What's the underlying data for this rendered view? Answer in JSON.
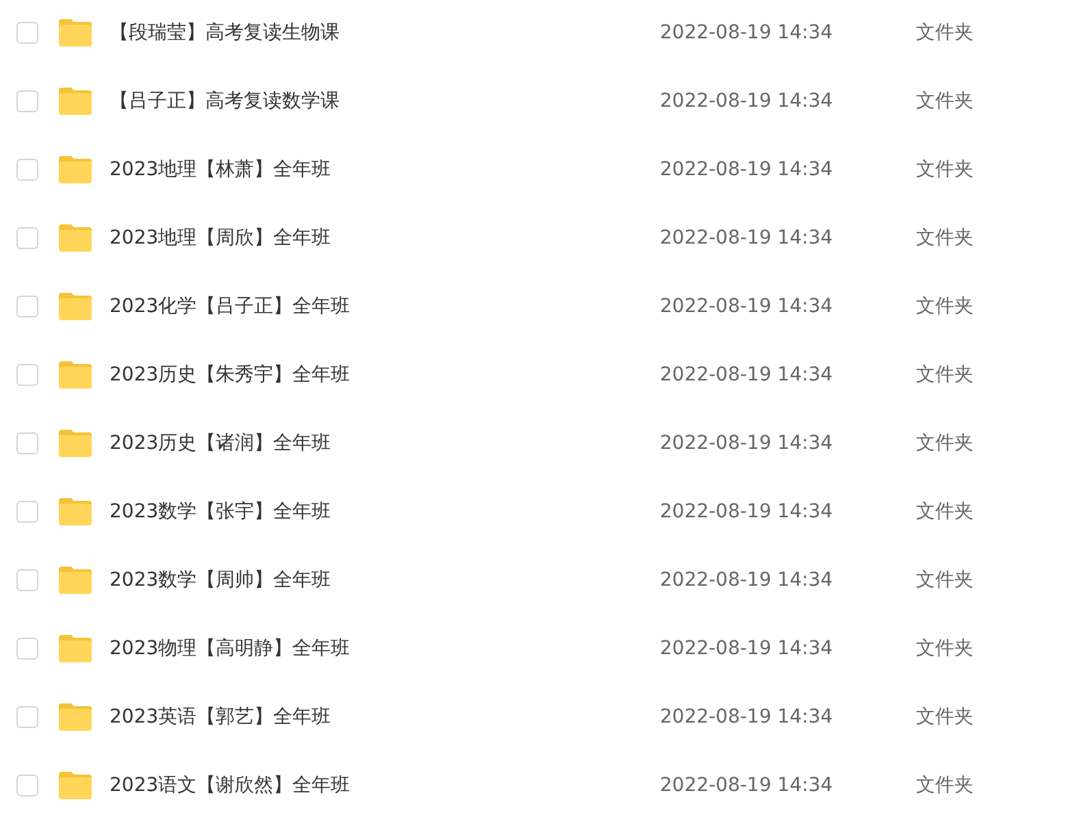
{
  "files": [
    {
      "name": "【段瑞莹】高考复读生物课",
      "modified": "2022-08-19 14:34",
      "type": "文件夹",
      "checked": false
    },
    {
      "name": "【吕子正】高考复读数学课",
      "modified": "2022-08-19 14:34",
      "type": "文件夹",
      "checked": false
    },
    {
      "name": "2023地理【林萧】全年班",
      "modified": "2022-08-19 14:34",
      "type": "文件夹",
      "checked": false
    },
    {
      "name": "2023地理【周欣】全年班",
      "modified": "2022-08-19 14:34",
      "type": "文件夹",
      "checked": false
    },
    {
      "name": "2023化学【吕子正】全年班",
      "modified": "2022-08-19 14:34",
      "type": "文件夹",
      "checked": false
    },
    {
      "name": "2023历史【朱秀宇】全年班",
      "modified": "2022-08-19 14:34",
      "type": "文件夹",
      "checked": false
    },
    {
      "name": "2023历史【诸润】全年班",
      "modified": "2022-08-19 14:34",
      "type": "文件夹",
      "checked": false
    },
    {
      "name": "2023数学【张宇】全年班",
      "modified": "2022-08-19 14:34",
      "type": "文件夹",
      "checked": false
    },
    {
      "name": "2023数学【周帅】全年班",
      "modified": "2022-08-19 14:34",
      "type": "文件夹",
      "checked": false
    },
    {
      "name": "2023物理【高明静】全年班",
      "modified": "2022-08-19 14:34",
      "type": "文件夹",
      "checked": false
    },
    {
      "name": "2023英语【郭艺】全年班",
      "modified": "2022-08-19 14:34",
      "type": "文件夹",
      "checked": false
    },
    {
      "name": "2023语文【谢欣然】全年班",
      "modified": "2022-08-19 14:34",
      "type": "文件夹",
      "checked": false
    }
  ]
}
